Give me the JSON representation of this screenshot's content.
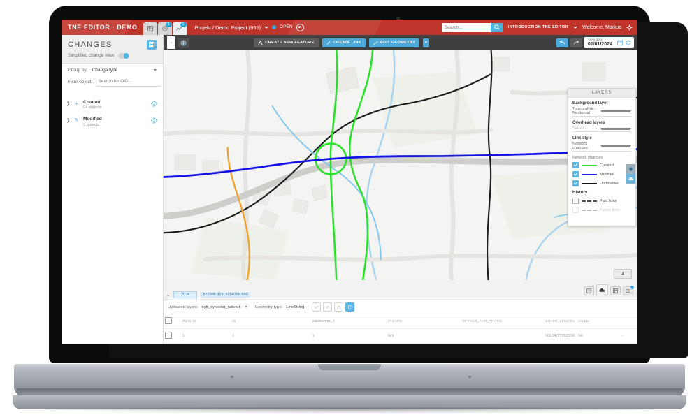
{
  "app": {
    "brand": "TNE EDITOR · DEMO",
    "project": "Projekt / Demo Project (965)",
    "status": "OPEN",
    "tabs": [
      {
        "name": "grid-tab",
        "icon": "grid-icon",
        "badge": ""
      },
      {
        "name": "history-tab",
        "icon": "clock-icon",
        "badge": "3"
      },
      {
        "name": "changes-tab",
        "icon": "chart-icon",
        "badge": "1"
      }
    ],
    "search": {
      "value": "",
      "placeholder": "Search..."
    },
    "help_menu": "INTRODUCTION TNE EDITOR",
    "welcome": "Welcome, Markus"
  },
  "sidebar": {
    "title": "CHANGES",
    "simplified_label": "Simplified change view",
    "simplified_on": true,
    "group_by_label": "Group by:",
    "group_by_value": "Change type",
    "filter_label": "Filter object:",
    "filter_placeholder": "Search for OID...",
    "filter_value": "",
    "clear_label": "×",
    "nodes": [
      {
        "name": "Created",
        "count": "94 objects",
        "color": "#5bb8e5",
        "glyph": "+"
      },
      {
        "name": "Modified",
        "count": "3 objects",
        "color": "#3a8fd4",
        "glyph": "✎"
      }
    ]
  },
  "toolbar": {
    "create_feature": "CREATE NEW FEATURE",
    "create_link": "CREATE LINK",
    "edit_geometry": "EDIT GEOMETRY",
    "more": "▾",
    "undo": "undo-icon",
    "redo": "redo-icon",
    "view_date_label": "View date",
    "view_date_value": "01/01/2024"
  },
  "layers": {
    "title": "LAYERS",
    "background_label": "Background layer",
    "background_value": "Topografisk - Nedtonad",
    "overhead_label": "Overhead layers",
    "overhead_value": "Select...",
    "link_style_label": "Link style",
    "link_style_value": "Network changes",
    "network_changes_label": "Network changes",
    "legend": [
      {
        "label": "Created",
        "color": "#33dd33",
        "checked": true
      },
      {
        "label": "Modified",
        "color": "#2222dd",
        "checked": true
      },
      {
        "label": "Unmodified",
        "color": "#111111",
        "checked": true
      }
    ],
    "history_label": "History",
    "history_items": [
      {
        "label": "Past links",
        "checked": false
      },
      {
        "label": "Future links",
        "checked": false
      }
    ]
  },
  "map": {
    "scale": "20 m",
    "coordinates": "522386.315, 6254765.693",
    "feature_count": "4",
    "dock_icons": [
      "basemap-icon",
      "cloud-upload-icon",
      "table-icon",
      "list-icon"
    ],
    "collapse": "‹"
  },
  "uploaded": {
    "layers_label": "Uploaded layers:",
    "layers_value": "nytt_cykelnat_natverk",
    "geometry_label": "Geometry type:",
    "geometry_value": "LineString",
    "tool_icons": [
      "snap-icon",
      "draw-icon",
      "split-icon",
      "select-icon"
    ]
  },
  "table": {
    "columns": [
      "ROW ID",
      "ID",
      "OBJECTID_1",
      "ATGARD",
      "OPPNAS_FOR_TRAFIK",
      "SHAPE_LENGTH",
      "Visible"
    ],
    "rows": [
      {
        "row_id": "1",
        "id": "1",
        "objectid_1": "1",
        "atgard": "Nytt",
        "oppnas_for_trafik": "",
        "shape_length": "569.542272125291",
        "visible": "No",
        "action": "···"
      }
    ]
  }
}
